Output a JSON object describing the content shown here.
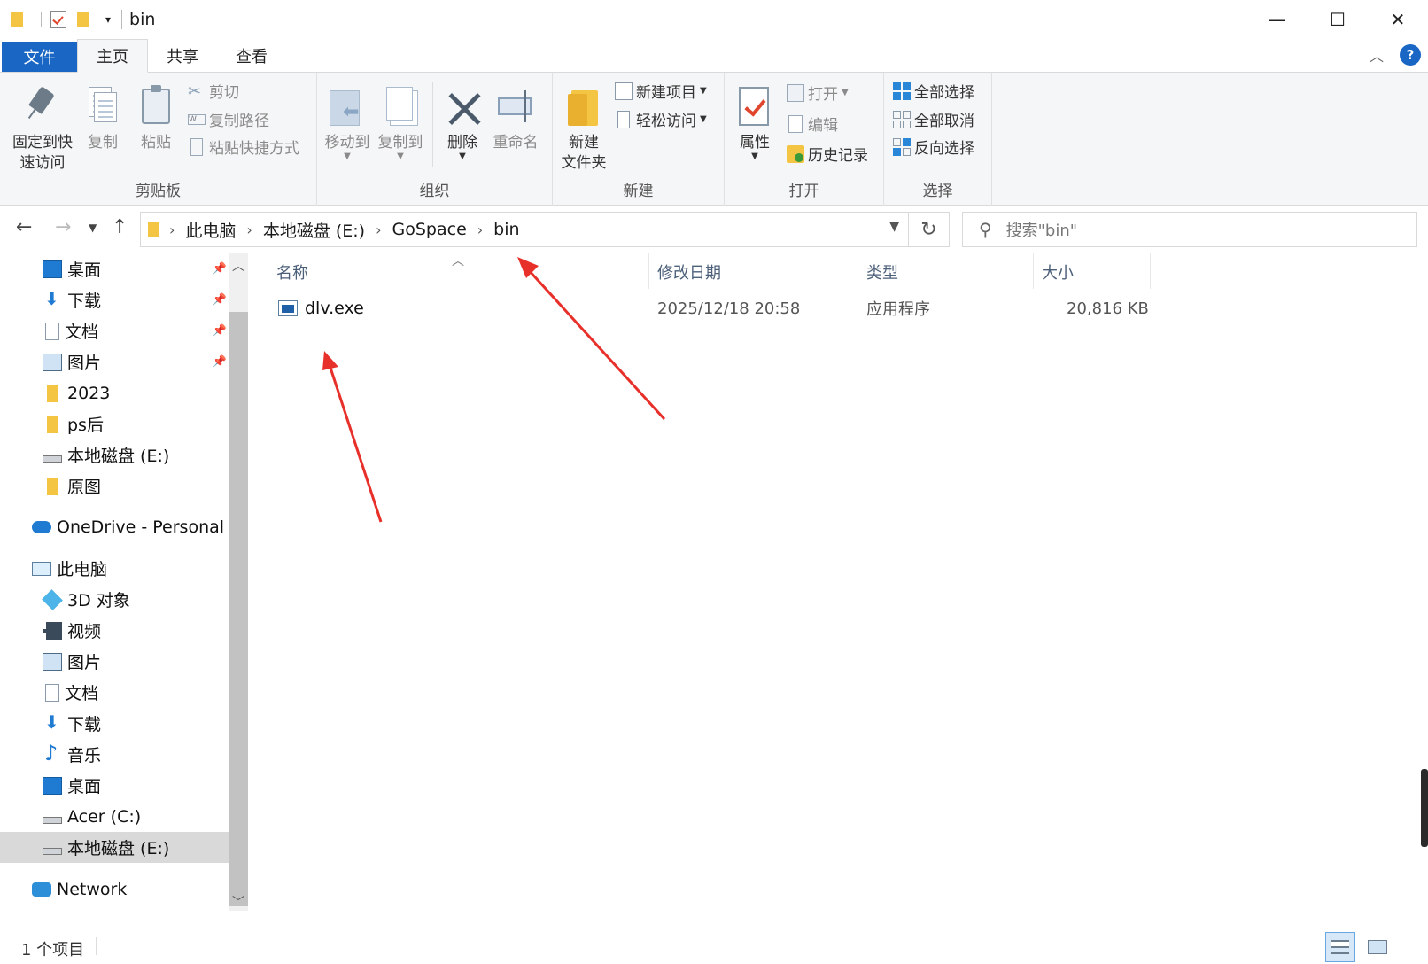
{
  "window": {
    "title": "bin",
    "controls": {
      "minimize": "—",
      "maximize": "☐",
      "close": "✕"
    }
  },
  "quick_access_toolbar": {
    "dropdown": "▾"
  },
  "tabs": [
    {
      "label": "文件"
    },
    {
      "label": "主页"
    },
    {
      "label": "共享"
    },
    {
      "label": "查看"
    }
  ],
  "ribbon": {
    "clipboard": {
      "pin_line1": "固定到快",
      "pin_line2": "速访问",
      "copy": "复制",
      "paste": "粘贴",
      "cut": "剪切",
      "copy_path": "复制路径",
      "paste_shortcut": "粘贴快捷方式",
      "label": "剪贴板"
    },
    "organize": {
      "move_to": "移动到",
      "copy_to": "复制到",
      "delete": "删除",
      "rename": "重命名",
      "label": "组织"
    },
    "new": {
      "new_folder_line1": "新建",
      "new_folder_line2": "文件夹",
      "new_item": "新建项目",
      "easy_access": "轻松访问",
      "label": "新建"
    },
    "open": {
      "properties": "属性",
      "open": "打开",
      "edit": "编辑",
      "history": "历史记录",
      "label": "打开"
    },
    "select": {
      "select_all": "全部选择",
      "select_none": "全部取消",
      "invert": "反向选择",
      "label": "选择"
    }
  },
  "address_bar": {
    "crumbs": [
      "此电脑",
      "本地磁盘 (E:)",
      "GoSpace",
      "bin"
    ],
    "search_placeholder": "搜索\"bin\""
  },
  "nav_pane": {
    "quick_access": [
      {
        "label": "桌面",
        "icon": "desktop-icon",
        "pinned": true
      },
      {
        "label": "下载",
        "icon": "download-icon",
        "pinned": true
      },
      {
        "label": "文档",
        "icon": "document-icon",
        "pinned": true
      },
      {
        "label": "图片",
        "icon": "picture-icon",
        "pinned": true
      },
      {
        "label": "2023",
        "icon": "folder-icon",
        "pinned": false
      },
      {
        "label": "ps后",
        "icon": "folder-icon",
        "pinned": false
      },
      {
        "label": "本地磁盘 (E:)",
        "icon": "drive-icon",
        "pinned": false
      },
      {
        "label": "原图",
        "icon": "folder-icon",
        "pinned": false
      }
    ],
    "onedrive": "OneDrive - Personal",
    "this_pc": "此电脑",
    "pc_items": [
      {
        "label": "3D 对象",
        "icon": "3d-objects-icon"
      },
      {
        "label": "视频",
        "icon": "video-icon"
      },
      {
        "label": "图片",
        "icon": "picture-icon"
      },
      {
        "label": "文档",
        "icon": "document-icon"
      },
      {
        "label": "下载",
        "icon": "download-icon"
      },
      {
        "label": "音乐",
        "icon": "music-icon"
      },
      {
        "label": "桌面",
        "icon": "desktop-icon"
      },
      {
        "label": "Acer (C:)",
        "icon": "drive-icon"
      },
      {
        "label": "本地磁盘 (E:)",
        "icon": "drive-icon",
        "selected": true
      }
    ],
    "network": "Network"
  },
  "file_list": {
    "columns": [
      "名称",
      "修改日期",
      "类型",
      "大小"
    ],
    "rows": [
      {
        "name": "dlv.exe",
        "modified": "2025/12/18 20:58",
        "type": "应用程序",
        "size": "20,816 KB"
      }
    ]
  },
  "status_bar": {
    "item_count": "1 个项目"
  },
  "colors": {
    "accent": "#1a66c4",
    "annotation": "#e8302a"
  }
}
